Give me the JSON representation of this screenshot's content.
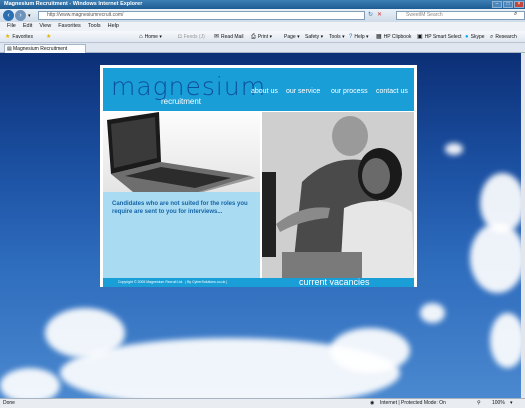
{
  "window": {
    "title": "Magnesium Recruitment - Windows Internet Explorer"
  },
  "address": {
    "url": "http://www.magnesiumrecruit.com/",
    "search_placeholder": "SweetIM Search"
  },
  "menu": [
    "File",
    "Edit",
    "View",
    "Favorites",
    "Tools",
    "Help"
  ],
  "toolbar": {
    "favorites": "Favorites",
    "home": "Home",
    "feeds": "Feeds (J)",
    "read_mail": "Read Mail",
    "print": "Print",
    "page": "Page",
    "safety": "Safety",
    "tools": "Tools",
    "help": "Help",
    "clipbook": "HP Clipbook",
    "smart_select": "HP Smart Select",
    "skype": "Skype",
    "research": "Research"
  },
  "tab": {
    "label": "Magnesium Recruitment"
  },
  "site": {
    "logo_main": "magnesium",
    "logo_sub": "recruitment",
    "nav": [
      "about us",
      "our service",
      "our process",
      "contact us"
    ],
    "tagline": "Candidates who are not suited for the roles you require are sent to you for interviews...",
    "copyright": "Copyright © 2005 Magnesium Recruit Ltd.",
    "credit": "| By CyberSolutions.co.uk |",
    "vacancies": "current vacancies"
  },
  "status": {
    "left": "Done",
    "zone": "Internet | Protected Mode: On",
    "zoom": "100%"
  },
  "colors": {
    "site_blue": "#1a9ed7",
    "logo_blue": "#0d4f9a",
    "tagline_blue": "#1565a8",
    "box_blue": "#a9dbf2"
  }
}
